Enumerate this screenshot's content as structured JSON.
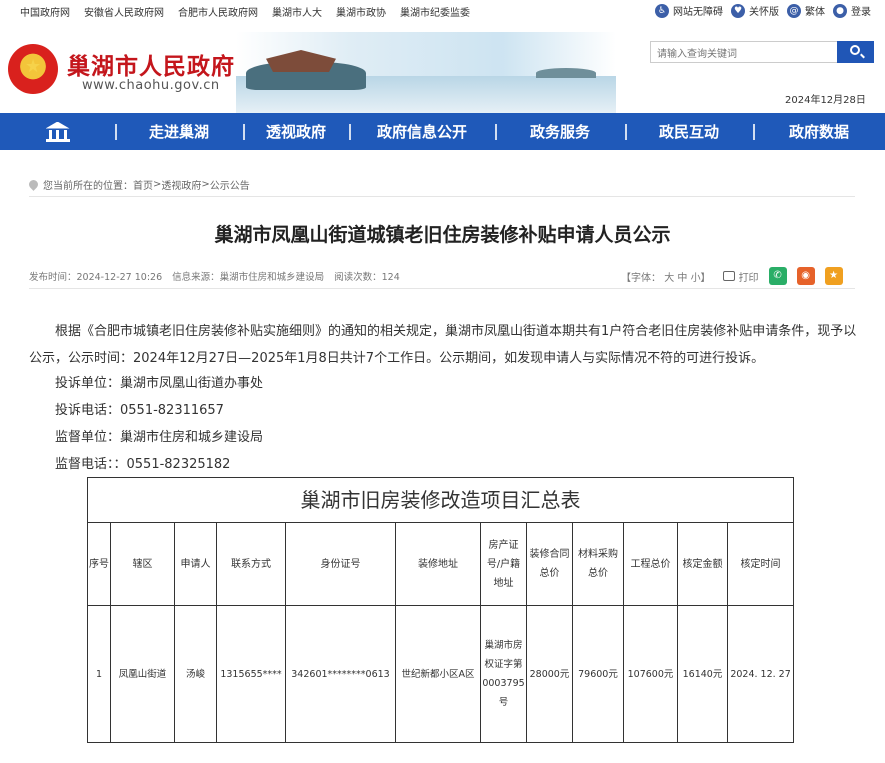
{
  "topbar": {
    "links": [
      "中国政府网",
      "安徽省人民政府网",
      "合肥市人民政府网",
      "巢湖市人大",
      "巢湖市政协",
      "巢湖市纪委监委"
    ],
    "tools": {
      "accessible": "网站无障碍",
      "care": "关怀版",
      "traditional": "繁体",
      "user": "登录"
    }
  },
  "header": {
    "site_title": "巢湖市人民政府",
    "site_url": "www.chaohu.gov.cn",
    "search_placeholder": "请输入查询关键词",
    "date": "2024年12月28日"
  },
  "nav": {
    "items": [
      "走进巢湖",
      "透视政府",
      "政府信息公开",
      "政务服务",
      "政民互动",
      "政府数据"
    ]
  },
  "breadcrumb": {
    "prefix": "您当前所在的位置：",
    "home": "首页",
    "sep1": " > ",
    "level1": "透视政府",
    "sep2": " > ",
    "level2": "公示公告"
  },
  "article": {
    "title": "巢湖市凤凰山街道城镇老旧住房装修补贴申请人员公示",
    "publish": "发布时间：2024-12-27 10:26",
    "source": "信息来源：巢湖市住房和城乡建设局",
    "views": "阅读次数：124",
    "font_label": "【字体：",
    "font_large": "大",
    "font_mid": "中",
    "font_small": "小】",
    "print": "打印",
    "paragraph": "根据《合肥市城镇老旧住房装修补贴实施细则》的通知的相关规定，巢湖市凤凰山街道本期共有1户符合老旧住房装修补贴申请条件，现予以公示，公示时间：2024年12月27日—2025年1月8日共计7个工作日。公示期间，如发现申请人与实际情况不符的可进行投诉。",
    "complaint_unit": "投诉单位：巢湖市凤凰山街道办事处",
    "complaint_phone": "投诉电话：0551-82311657",
    "supervise_unit": "监督单位：巢湖市住房和城乡建设局",
    "supervise_phone": "监督电话：：0551-82325182"
  },
  "table": {
    "caption": "巢湖市旧房装修改造项目汇总表",
    "headers": [
      "序号",
      "辖区",
      "申请人",
      "联系方式",
      "身份证号",
      "装修地址",
      "房产证号/户籍地址",
      "装修合同总价",
      "材料采购总价",
      "工程总价",
      "核定金额",
      "核定时间"
    ],
    "rows": [
      [
        "1",
        "凤凰山街道",
        "汤峻",
        "1315655****",
        "342601********0613",
        "世纪新都小区A区",
        "巢湖市房权证字第0003795号",
        "28000元",
        "79600元",
        "107600元",
        "16140元",
        "2024. 12. 27"
      ]
    ]
  },
  "colors": {
    "nav": "#1f59b9",
    "title_red": "#c4161c",
    "search_btn": "#2056b6",
    "wechat": "#2aae67",
    "weibo": "#e6622a",
    "favorite": "#f0a020"
  }
}
